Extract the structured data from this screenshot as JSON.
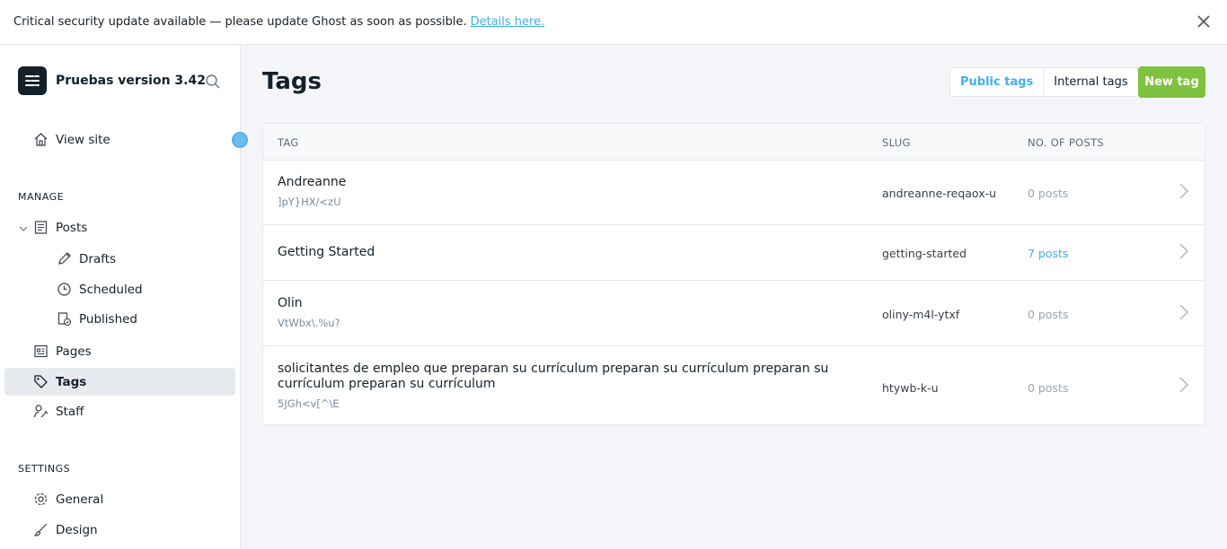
{
  "banner": {
    "message": "Critical security update available — please update Ghost as soon as possible.",
    "link": "Details here."
  },
  "sidebar": {
    "site_title": "Pruebas version 3.42",
    "view_site": "View site",
    "manage_label": "MANAGE",
    "settings_label": "SETTINGS",
    "items": {
      "posts": "Posts",
      "drafts": "Drafts",
      "scheduled": "Scheduled",
      "published": "Published",
      "pages": "Pages",
      "tags": "Tags",
      "staff": "Staff",
      "general": "General",
      "design": "Design"
    }
  },
  "main": {
    "title": "Tags",
    "toggle": {
      "public": "Public tags",
      "internal": "Internal tags"
    },
    "new_button": "New tag",
    "columns": {
      "tag": "TAG",
      "slug": "SLUG",
      "posts": "NO. OF POSTS"
    },
    "rows": [
      {
        "name": "Andreanne",
        "description": "]pY}HX/<zU",
        "slug": "andreanne-reqaox-u",
        "posts": "0 posts"
      },
      {
        "name": "Getting Started",
        "description": "",
        "slug": "getting-started",
        "posts": "7 posts"
      },
      {
        "name": "Olin",
        "description": "VtWbx\\.%u?",
        "slug": "oliny-m4l-ytxf",
        "posts": "0 posts"
      },
      {
        "name": "solicitantes de empleo que preparan su currículum preparan su currículum preparan su currículum preparan su currículum",
        "description": "5JGh<v[^\\E",
        "slug": "htywb-k-u",
        "posts": "0 posts"
      }
    ]
  },
  "colors": {
    "accent": "#3eb0ef",
    "primary_button": "#7fc23f",
    "notification_dot": "#6bbdf1"
  }
}
